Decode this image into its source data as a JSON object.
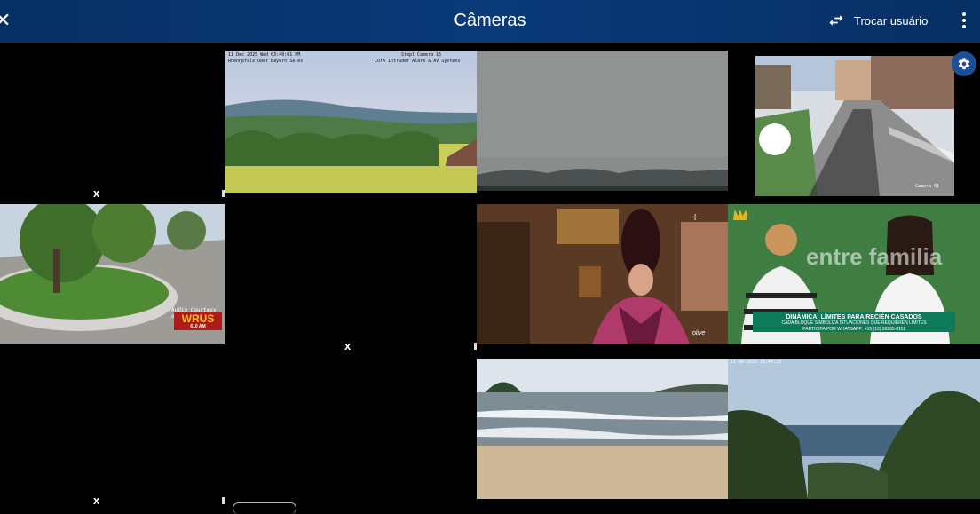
{
  "header": {
    "title": "Câmeras",
    "switch_user_label": "Trocar usuário"
  },
  "cameras": {
    "cam1": {
      "overlay_line1": "11 Dec 2025 Wed 03:40:01 PM",
      "overlay_line2": "Rhennpfalz Ober Bayern Sales",
      "overlay_right1": "Stepl Camera 15",
      "overlay_right2": "COTA Intruder Alarm & AV Systems"
    },
    "cam4": {
      "label": "Camera 01"
    },
    "cam5": {
      "brand": "WRUS",
      "brand_sub": "610 AM",
      "credit": "Audio Courtesy of"
    },
    "cam8": {
      "logo": "olive"
    },
    "cam9": {
      "watermark": "entre familia",
      "banner_title": "DINÁMICA: LÍMITES PARA RECIÉN CASADOS",
      "banner_line2": "CADA BLOQUE SIMBOLIZA SITUACIONES QUE REQUIEREN LÍMITES",
      "banner_line3": "PARTICIPA POR WHATSAPP: +55 (12) 98283-0111"
    },
    "cam11": {
      "overlay": "11-06-2025 15:04:33"
    }
  },
  "placeholders": {
    "closed_mark": "x"
  }
}
